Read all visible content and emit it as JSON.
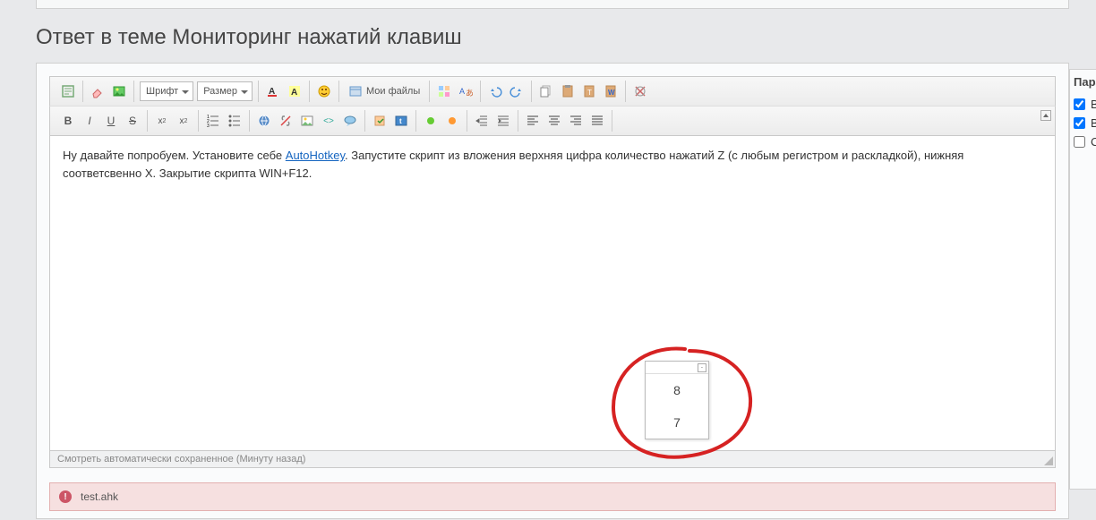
{
  "page": {
    "title": "Ответ в теме Мониторинг нажатий клавиш"
  },
  "toolbar": {
    "font_label": "Шрифт",
    "size_label": "Размер",
    "my_files_label": "Мои файлы"
  },
  "editor": {
    "text_before_link": "Ну давайте попробуем. Установите себе ",
    "link_text": "AutoHotkey",
    "text_after_link": ". Запустите скрипт из вложения верхняя цифра количество нажатий Z (с любым регистром и раскладкой), нижняя соответсвенно X. Закрытие скрипта WIN+F12."
  },
  "status": {
    "autosave": "Смотреть автоматически сохраненное (Минуту назад)"
  },
  "attachment": {
    "filename": "test.ahk"
  },
  "popup": {
    "val1": "8",
    "val2": "7"
  },
  "side": {
    "title": "Пара",
    "opt1": "В",
    "opt2": "В",
    "opt3": "С"
  }
}
